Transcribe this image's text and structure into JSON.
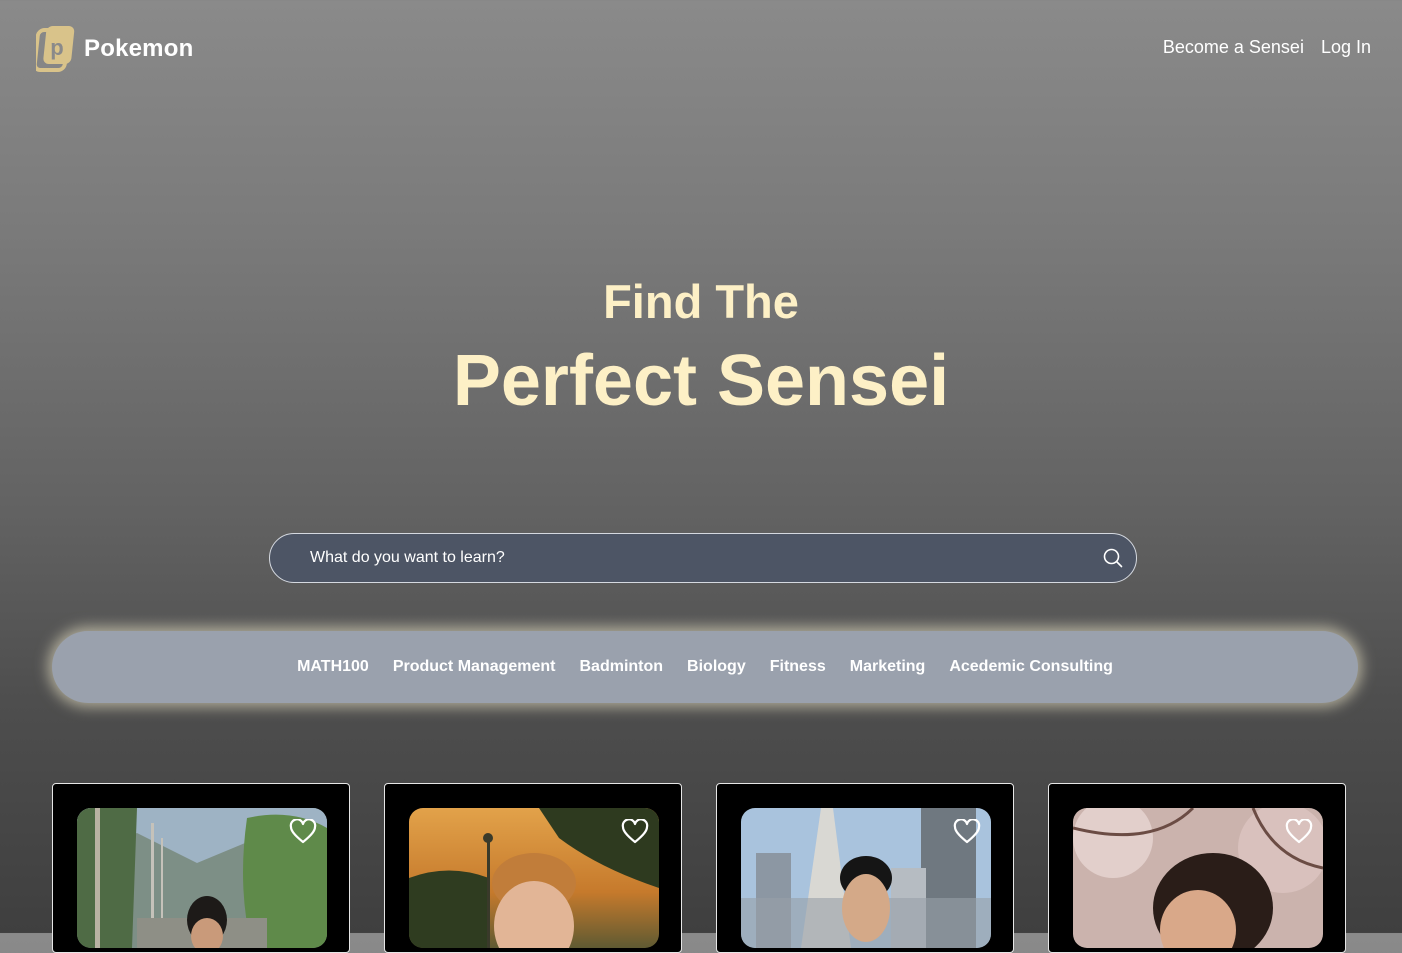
{
  "brand": {
    "name": "Pokemon",
    "logo_icon": "p-tile-logo-icon",
    "accent_color": "#d9c38a"
  },
  "nav": {
    "become_sensei": "Become a Sensei",
    "log_in": "Log In"
  },
  "hero": {
    "line1": "Find The",
    "line2": "Perfect Sensei",
    "text_color": "#fdf0c6"
  },
  "search": {
    "placeholder": "What do you want to learn?",
    "value": "",
    "icon": "search-icon"
  },
  "categories": [
    "MATH100",
    "Product Management",
    "Badminton",
    "Biology",
    "Fitness",
    "Marketing",
    "Acedemic Consulting"
  ],
  "senseis": [
    {
      "photo": "person on tree-lined street",
      "favorite_icon": "heart-outline-icon"
    },
    {
      "photo": "person at sunset park",
      "favorite_icon": "heart-outline-icon"
    },
    {
      "photo": "person in front of city skyline",
      "favorite_icon": "heart-outline-icon"
    },
    {
      "photo": "person under blossoming tree",
      "favorite_icon": "heart-outline-icon"
    }
  ]
}
